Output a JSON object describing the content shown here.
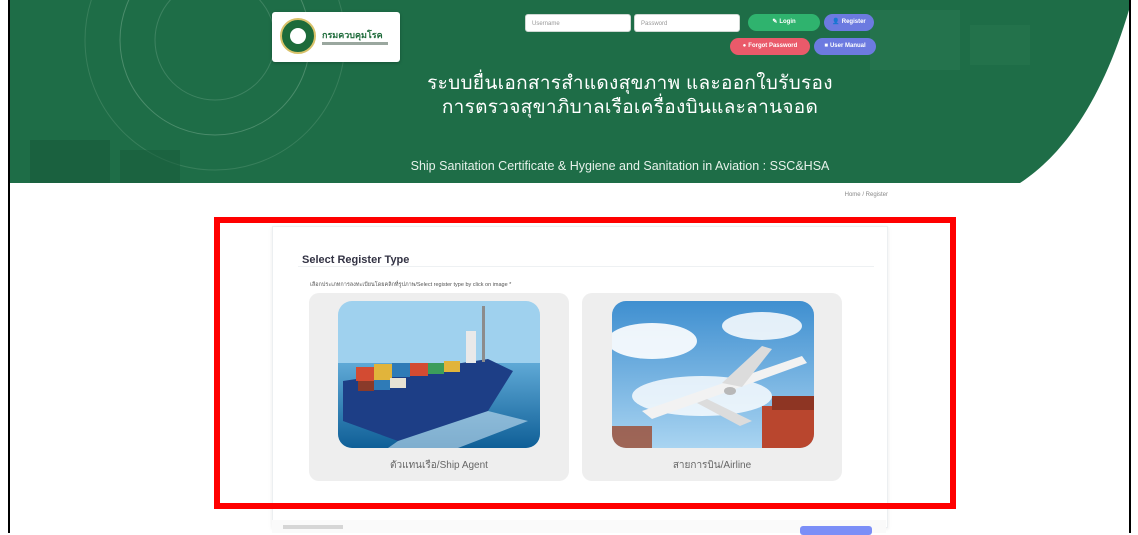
{
  "header": {
    "logo_text": "กรมควบคุมโรค",
    "title_th_line1": "ระบบยื่นเอกสารสำแดงสุขภาพ และออกใบรับรอง",
    "title_th_line2": "การตรวจสุขาภิบาลเรือเครื่องบินและลานจอด",
    "title_en": "Ship Sanitation Certificate & Hygiene and Sanitation in Aviation : SSC&HSA",
    "username_placeholder": "Username",
    "password_placeholder": "Password",
    "login_label": "Login",
    "register_label": "Register",
    "forgot_label": "Forgot Password",
    "manual_label": "User Manual"
  },
  "breadcrumb": "Home / Register",
  "card": {
    "title": "Select Register Type",
    "note": "เลือกประเภทการลงทะเบียนโดยคลิกที่รูปภาพ/Select register type by click on image *",
    "options": [
      {
        "label": "ตัวแทนเรือ/Ship Agent",
        "image": "container-ship"
      },
      {
        "label": "สายการบิน/Airline",
        "image": "airplane"
      }
    ]
  },
  "colors": {
    "header_green": "#1e6d47",
    "login_green": "#2fb36e",
    "register_blue": "#6c7ae0",
    "forgot_red": "#ea5a6a",
    "manual_blue": "#6c7ae0",
    "highlight_red": "#ff0000"
  }
}
